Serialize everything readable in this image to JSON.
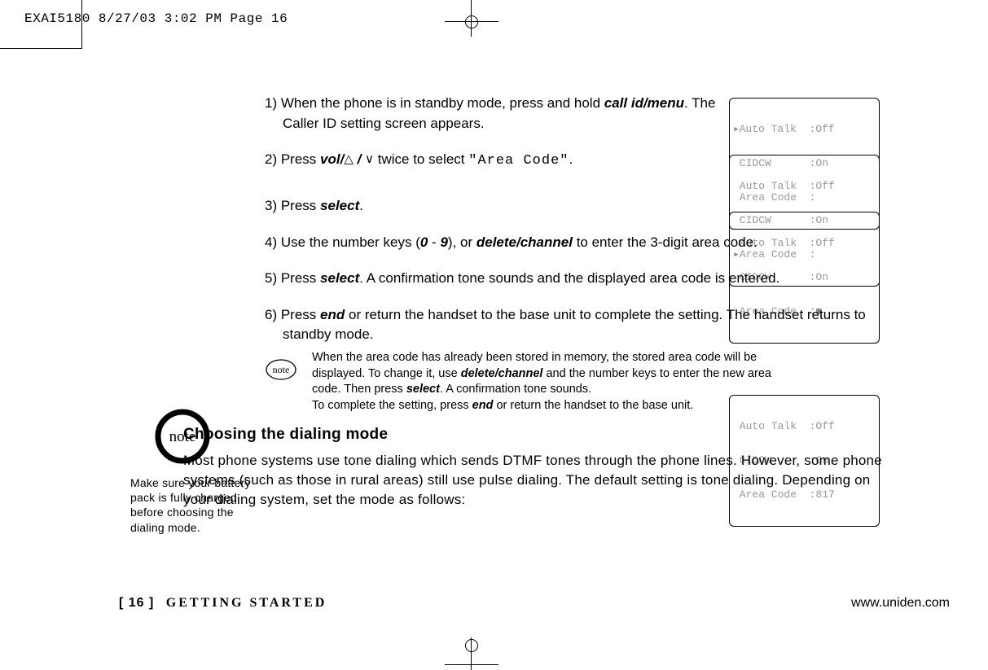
{
  "slug": "EXAI5180  8/27/03 3:02 PM  Page 16",
  "steps": {
    "s1a": "1) When the phone is in standby mode, press and hold ",
    "s1b": "call id/menu",
    "s1c": ". The Caller ID setting screen appears.",
    "s2a": "2) Press ",
    "s2b": "vol/",
    "s2c": " twice to select ",
    "s2d": "\"Area Code\"",
    "s2e": ".",
    "s3a": "3) Press ",
    "s3b": "select",
    "s3c": ".",
    "s4a": "4) Use the number keys (",
    "s4b": "0",
    "s4c": " - ",
    "s4d": "9",
    "s4e": "), or ",
    "s4f": "delete/channel",
    "s4g": " to enter the 3-digit area code.",
    "s5a": "5) Press ",
    "s5b": "select",
    "s5c": ". A confirmation tone sounds and the displayed area code is entered.",
    "s6a": "6) Press ",
    "s6b": "end",
    "s6c": " or return the handset to the base unit to complete the setting. The handset returns to standby mode."
  },
  "note_small": {
    "a": "When the area code has already been stored in memory, the stored area code will be displayed. To change it, use ",
    "b": "delete/channel",
    "c": " and the number keys to enter the new area code. Then press ",
    "d": "select",
    "e": ". A confirmation tone sounds.",
    "f": "To complete the setting, press ",
    "g": "end",
    "h": " or return the handset to the base unit."
  },
  "heading": "Choosing the dialing mode",
  "paragraph": "Most phone systems use tone dialing which sends DTMF tones through the phone lines. However, some phone systems (such as those in rural areas) still use pulse dialing. The default setting is tone dialing. Depending on your dialing system, set the mode as follows:",
  "sidebar_note": "Make sure your battery pack is fully charged before choosing the dialing mode.",
  "note_label": "note",
  "lcd1": {
    "l1": " Auto Talk  :Off",
    "sel": "▸",
    "l2": " CIDCW      :On",
    "l3": " Area Code  :"
  },
  "lcd2": {
    "l1": " Auto Talk  :Off",
    "l2": " CIDCW      :On",
    "sel": "▸",
    "l3": "Area Code  :"
  },
  "lcd3": {
    "l1": " Auto Talk  :Off",
    "l2": " CIDCW      :On",
    "l3": " Area Code  :",
    "cur": "■"
  },
  "lcd4": {
    "l1": " Auto Talk  :Off",
    "l2": " CIDCW      :On",
    "l3": " Area Code  :81",
    "cur": "7"
  },
  "footer": {
    "page": "[ 16 ]",
    "section": "GETTING STARTED",
    "url": "www.uniden.com"
  },
  "icons": {
    "up": "△",
    "down": "∨",
    "slash": " / "
  }
}
